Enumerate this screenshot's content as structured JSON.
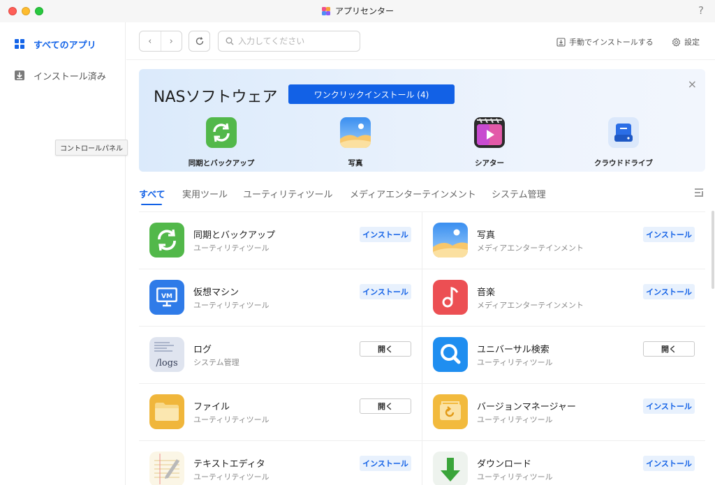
{
  "window": {
    "title": "アプリセンター",
    "help": "?"
  },
  "sidebar": {
    "items": [
      {
        "label": "すべてのアプリ",
        "icon": "grid-icon",
        "active": true
      },
      {
        "label": "インストール済み",
        "icon": "download-box-icon",
        "active": false
      }
    ],
    "tooltip": "コントロールパネル"
  },
  "toolbar": {
    "back": "‹",
    "forward": "›",
    "search_placeholder": "入力してください",
    "manual_install": "手動でインストールする",
    "settings": "設定"
  },
  "banner": {
    "title": "NASソフトウェア",
    "oneclick_label": "ワンクリックインストール (4)",
    "close": "×",
    "featured": [
      {
        "label": "同期とバックアップ",
        "icon": "sync-icon"
      },
      {
        "label": "写真",
        "icon": "photo-icon"
      },
      {
        "label": "シアター",
        "icon": "theater-icon"
      },
      {
        "label": "クラウドドライブ",
        "icon": "cloud-drive-icon"
      }
    ]
  },
  "tabs": [
    {
      "label": "すべて",
      "active": true
    },
    {
      "label": "実用ツール",
      "active": false
    },
    {
      "label": "ユーティリティツール",
      "active": false
    },
    {
      "label": "メディアエンターテインメント",
      "active": false
    },
    {
      "label": "システム管理",
      "active": false
    }
  ],
  "apps": [
    {
      "name": "同期とバックアップ",
      "category": "ユーティリティツール",
      "action": "インストール",
      "icon": "sync-icon"
    },
    {
      "name": "写真",
      "category": "メディアエンターテインメント",
      "action": "インストール",
      "icon": "photo-icon"
    },
    {
      "name": "仮想マシン",
      "category": "ユーティリティツール",
      "action": "インストール",
      "icon": "vm-icon",
      "icon_text": "VM"
    },
    {
      "name": "音楽",
      "category": "メディアエンターテインメント",
      "action": "インストール",
      "icon": "music-icon"
    },
    {
      "name": "ログ",
      "category": "システム管理",
      "action": "開く",
      "icon": "logs-icon",
      "icon_text": "/logs"
    },
    {
      "name": "ユニバーサル検索",
      "category": "ユーティリティツール",
      "action": "開く",
      "icon": "search-app-icon"
    },
    {
      "name": "ファイル",
      "category": "ユーティリティツール",
      "action": "開く",
      "icon": "folder-icon"
    },
    {
      "name": "バージョンマネージャー",
      "category": "ユーティリティツール",
      "action": "インストール",
      "icon": "version-manager-icon"
    },
    {
      "name": "テキストエディタ",
      "category": "ユーティリティツール",
      "action": "インストール",
      "icon": "text-editor-icon"
    },
    {
      "name": "ダウンロード",
      "category": "ユーティリティツール",
      "action": "インストール",
      "icon": "download-arrow-icon"
    }
  ],
  "colors": {
    "accent": "#1261e6",
    "install_bg": "#e8f1fd"
  }
}
